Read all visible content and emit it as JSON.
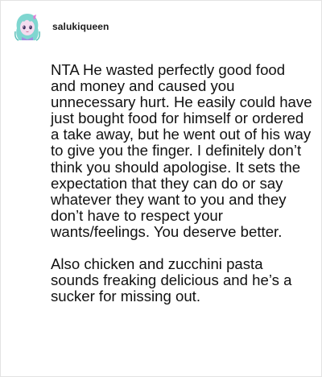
{
  "post": {
    "username": "salukiqueen",
    "paragraphs": [
      "NTA He wasted perfectly good food and money and caused you unnecessary hurt. He easily could have just bought food for himself or ordered a take away, but he went out of his way to give you the finger. I definitely don’t think you should apologise. It sets the expectation that they can do or say whatever they want to you and they don’t have to respect your wants/feelings. You deserve better.",
      "Also chicken and zucchini pasta sounds freaking delicious and he’s a sucker for missing out."
    ]
  },
  "colors": {
    "avatar_hair": "#7fd6d0",
    "avatar_face": "#f4dcef",
    "avatar_accent": "#e07ad6",
    "border": "#e3e3e3"
  },
  "icons": {
    "avatar": "anime-girl-avatar-icon"
  }
}
